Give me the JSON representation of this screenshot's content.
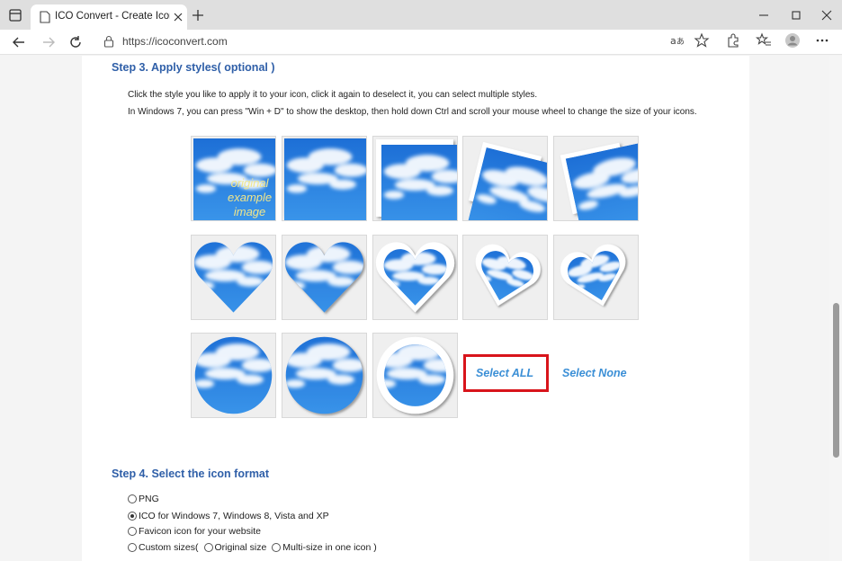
{
  "browser": {
    "tab_title": "ICO Convert - Create Icons From",
    "url": "https://icoconvert.com"
  },
  "step3": {
    "heading": "Step 3. Apply styles( optional )",
    "line1": "Click the style you like to apply it to your icon, click it again to deselect it, you can select multiple styles.",
    "line2": "In Windows 7, you can press \"Win + D\" to show the desktop, then hold down Ctrl and scroll your mouse wheel to change the size of your icons.",
    "original_label": [
      "original",
      "example",
      "image"
    ],
    "select_all": "Select ALL",
    "select_none": "Select None"
  },
  "step4": {
    "heading": "Step 4. Select the icon format",
    "options": [
      {
        "label": "PNG",
        "checked": false
      },
      {
        "label": "ICO for Windows 7, Windows 8, Vista and XP",
        "checked": true
      },
      {
        "label": "Favicon icon for your website",
        "checked": false
      }
    ],
    "custom_sizes_prefix": "Custom sizes(",
    "original_size": "Original size",
    "multi_size": "Multi-size in one icon )"
  },
  "colors": {
    "heading": "#2f5fa8",
    "link": "#3b8fd6",
    "highlight": "#d8141b",
    "sky": "#2b86e0"
  }
}
